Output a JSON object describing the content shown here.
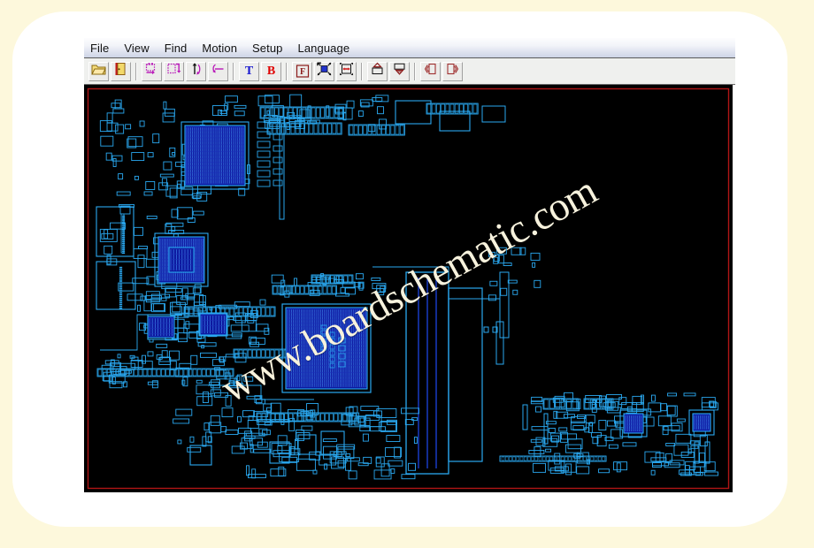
{
  "window": {
    "menu": {
      "items": [
        {
          "name": "file",
          "label": "File"
        },
        {
          "name": "view",
          "label": "View"
        },
        {
          "name": "find",
          "label": "Find"
        },
        {
          "name": "motion",
          "label": "Motion"
        },
        {
          "name": "setup",
          "label": "Setup"
        },
        {
          "name": "language",
          "label": "Language"
        }
      ]
    },
    "toolbar": {
      "buttons": [
        {
          "name": "open-file-button",
          "icon": "open-folder-icon",
          "title": "Open"
        },
        {
          "name": "exit-button",
          "icon": "exit-door-icon",
          "title": "Exit"
        },
        {
          "sep": true
        },
        {
          "name": "rotate-board-button",
          "icon": "rotate-board-icon",
          "title": "Rotate board"
        },
        {
          "name": "flip-board-button",
          "icon": "flip-board-icon",
          "title": "Flip board"
        },
        {
          "name": "mirror-vertical-button",
          "icon": "mirror-vertical-icon",
          "title": "Mirror vertical"
        },
        {
          "name": "mirror-horizontal-button",
          "icon": "mirror-horizontal-icon",
          "title": "Mirror horizontal"
        },
        {
          "sep": true
        },
        {
          "name": "top-layer-button",
          "icon": "letter-t-icon",
          "label": "T",
          "color": "#1a1ad0",
          "title": "Top layer"
        },
        {
          "name": "bottom-layer-button",
          "icon": "letter-b-icon",
          "label": "B",
          "color": "#e00000",
          "title": "Bottom layer"
        },
        {
          "sep": true
        },
        {
          "name": "find-component-button",
          "icon": "letter-f-boxed-icon",
          "label": "F",
          "color": "#8b1a1a",
          "title": "Find"
        },
        {
          "name": "zoom-fit-button",
          "icon": "zoom-fit-icon",
          "title": "Zoom fit"
        },
        {
          "name": "zoom-window-button",
          "icon": "zoom-window-icon",
          "title": "Zoom window"
        },
        {
          "sep": true
        },
        {
          "name": "pan-up-button",
          "icon": "pan-up-icon",
          "title": "Pan up"
        },
        {
          "name": "pan-down-button",
          "icon": "pan-down-icon",
          "title": "Pan down"
        },
        {
          "sep": true
        },
        {
          "name": "previous-part-button",
          "icon": "previous-part-icon",
          "title": "Previous"
        },
        {
          "name": "next-part-button",
          "icon": "next-part-icon",
          "title": "Next"
        }
      ]
    },
    "canvas": {
      "watermark": "www.boardschematic.com",
      "background_color": "#000000",
      "border_color": "#b01515",
      "trace_color": "#2aa8f0",
      "pad_fill_color": "#1a1ae0"
    }
  },
  "theme": {
    "page_background": "#fdf8dc",
    "sheet_background": "#ffffff",
    "menu_text": "#111111"
  }
}
